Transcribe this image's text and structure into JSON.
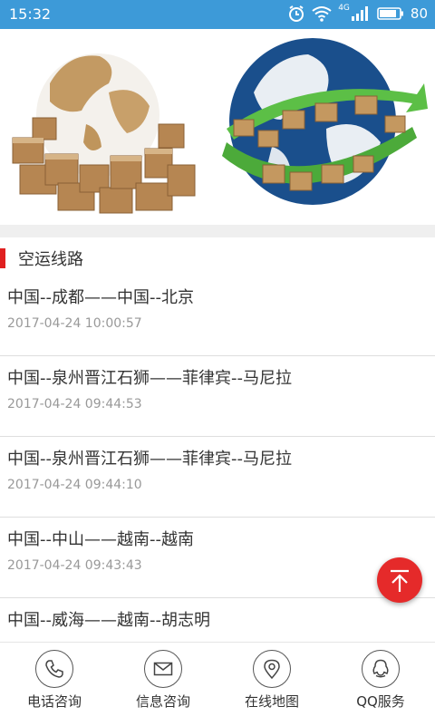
{
  "status_bar": {
    "time": "15:32",
    "battery": "80",
    "network": "4G"
  },
  "section": {
    "title": "空运线路"
  },
  "routes": [
    {
      "name": "中国--成都——中国--北京",
      "time": "2017-04-24 10:00:57"
    },
    {
      "name": "中国--泉州晋江石狮——菲律宾--马尼拉",
      "time": "2017-04-24 09:44:53"
    },
    {
      "name": "中国--泉州晋江石狮——菲律宾--马尼拉",
      "time": "2017-04-24 09:44:10"
    },
    {
      "name": "中国--中山——越南--越南",
      "time": "2017-04-24 09:43:43"
    },
    {
      "name": "中国--威海——越南--胡志明",
      "time": ""
    }
  ],
  "fab": {
    "icon": "arrow-up-to-top-icon",
    "color": "#e52a2a"
  },
  "bottom_nav": [
    {
      "label": "电话咨询",
      "icon": "phone-icon"
    },
    {
      "label": "信息咨询",
      "icon": "envelope-icon"
    },
    {
      "label": "在线地图",
      "icon": "map-pin-icon"
    },
    {
      "label": "QQ服务",
      "icon": "qq-penguin-icon"
    }
  ],
  "colors": {
    "status_bar": "#3d9ad8",
    "accent": "#e02020"
  }
}
